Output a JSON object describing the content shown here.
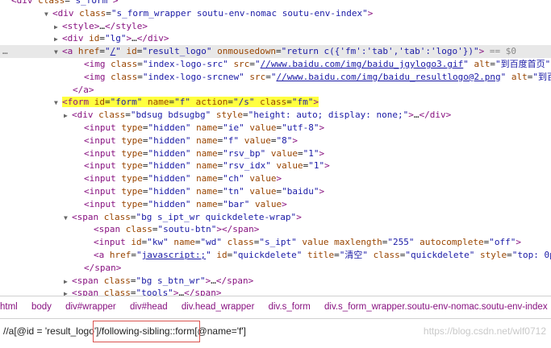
{
  "elements_panel": {
    "lines": [
      {
        "indent": 14,
        "caret": "",
        "html": "<span class='tag'>&lt;div</span> <span class='an'>class</span>=<span class='av'>\"s_form\"</span><span class='tag'>&gt;</span>"
      },
      {
        "indent": 66,
        "caret": "▼",
        "html": "<span class='tag'>&lt;div</span> <span class='an'>class</span>=<span class='av'>\"s_form_wrapper soutu-env-nomac soutu-env-index\"</span><span class='tag'>&gt;</span>"
      },
      {
        "indent": 78,
        "caret": "▶",
        "html": "<span class='tag'>&lt;style&gt;</span>…<span class='tag'>&lt;/style&gt;</span>"
      },
      {
        "indent": 78,
        "caret": "▶",
        "html": "<span class='tag'>&lt;div</span> <span class='an'>id</span>=<span class='av'>\"lg\"</span><span class='tag'>&gt;</span>…<span class='tag'>&lt;/div&gt;</span>"
      },
      {
        "indent": 78,
        "caret": "▼",
        "selected": true,
        "dot": true,
        "html": "<span class='tag'>&lt;a</span> <span class='an'>href</span>=<span class='av'>\"<span class='link'>/</span>\"</span> <span class='an'>id</span>=<span class='av'>\"result_logo\"</span> <span class='an'>onmousedown</span>=<span class='av'>\"return c({'fm':'tab','tab':'logo'})\"</span><span class='tag'>&gt;</span> <span class='dim'>== $0</span>"
      },
      {
        "indent": 104,
        "caret": "",
        "html": "<span class='tag'>&lt;img</span> <span class='an'>class</span>=<span class='av'>\"index-logo-src\"</span> <span class='an'>src</span>=<span class='av'>\"<span class='link'>//www.baidu.com/img/baidu_jgylogo3.gif</span>\"</span> <span class='an'>alt</span>=<span class='av'>\"到百度首页\"</span>"
      },
      {
        "indent": 104,
        "caret": "",
        "html": "<span class='tag'>&lt;img</span> <span class='an'>class</span>=<span class='av'>\"index-logo-srcnew\"</span> <span class='an'>src</span>=<span class='av'>\"<span class='link'>//www.baidu.com/img/baidu_resultlogo@2.png</span>\"</span> <span class='an'>alt</span>=<span class='av'>\"到百</span>"
      },
      {
        "indent": 90,
        "caret": "",
        "html": "<span class='tag'>&lt;/a&gt;</span>"
      },
      {
        "indent": 78,
        "caret": "▼",
        "html": "<span class='hl'><span class='tag'>&lt;form</span> <span class='an'>id</span>=<span class='av'>\"form\"</span> <span class='an'>name</span>=<span class='av'>\"f\"</span> <span class='an'>action</span>=<span class='av'>\"/s\"</span> <span class='an'>class</span>=<span class='av'>\"fm\"</span><span class='tag'>&gt;</span></span>"
      },
      {
        "indent": 90,
        "caret": "▶",
        "html": "<span class='tag'>&lt;div</span> <span class='an'>class</span>=<span class='av'>\"bdsug bdsugbg\"</span> <span class='an'>style</span>=<span class='av'>\"height: auto; display: none;\"</span><span class='tag'>&gt;</span>…<span class='tag'>&lt;/div&gt;</span>"
      },
      {
        "indent": 104,
        "caret": "",
        "html": "<span class='tag'>&lt;input</span> <span class='an'>type</span>=<span class='av'>\"hidden\"</span> <span class='an'>name</span>=<span class='av'>\"ie\"</span> <span class='an'>value</span>=<span class='av'>\"utf-8\"</span><span class='tag'>&gt;</span>"
      },
      {
        "indent": 104,
        "caret": "",
        "html": "<span class='tag'>&lt;input</span> <span class='an'>type</span>=<span class='av'>\"hidden\"</span> <span class='an'>name</span>=<span class='av'>\"f\"</span> <span class='an'>value</span>=<span class='av'>\"8\"</span><span class='tag'>&gt;</span>"
      },
      {
        "indent": 104,
        "caret": "",
        "html": "<span class='tag'>&lt;input</span> <span class='an'>type</span>=<span class='av'>\"hidden\"</span> <span class='an'>name</span>=<span class='av'>\"rsv_bp\"</span> <span class='an'>value</span>=<span class='av'>\"1\"</span><span class='tag'>&gt;</span>"
      },
      {
        "indent": 104,
        "caret": "",
        "html": "<span class='tag'>&lt;input</span> <span class='an'>type</span>=<span class='av'>\"hidden\"</span> <span class='an'>name</span>=<span class='av'>\"rsv_idx\"</span> <span class='an'>value</span>=<span class='av'>\"1\"</span><span class='tag'>&gt;</span>"
      },
      {
        "indent": 104,
        "caret": "",
        "html": "<span class='tag'>&lt;input</span> <span class='an'>type</span>=<span class='av'>\"hidden\"</span> <span class='an'>name</span>=<span class='av'>\"ch\"</span> <span class='an'>value</span><span class='tag'>&gt;</span>"
      },
      {
        "indent": 104,
        "caret": "",
        "html": "<span class='tag'>&lt;input</span> <span class='an'>type</span>=<span class='av'>\"hidden\"</span> <span class='an'>name</span>=<span class='av'>\"tn\"</span> <span class='an'>value</span>=<span class='av'>\"baidu\"</span><span class='tag'>&gt;</span>"
      },
      {
        "indent": 104,
        "caret": "",
        "html": "<span class='tag'>&lt;input</span> <span class='an'>type</span>=<span class='av'>\"hidden\"</span> <span class='an'>name</span>=<span class='av'>\"bar\"</span> <span class='an'>value</span><span class='tag'>&gt;</span>"
      },
      {
        "indent": 90,
        "caret": "▼",
        "html": "<span class='tag'>&lt;span</span> <span class='an'>class</span>=<span class='av'>\"bg s_ipt_wr quickdelete-wrap\"</span><span class='tag'>&gt;</span>"
      },
      {
        "indent": 116,
        "caret": "",
        "html": "<span class='tag'>&lt;span</span> <span class='an'>class</span>=<span class='av'>\"soutu-btn\"</span><span class='tag'>&gt;&lt;/span&gt;</span>"
      },
      {
        "indent": 116,
        "caret": "",
        "html": "<span class='tag'>&lt;input</span> <span class='an'>id</span>=<span class='av'>\"kw\"</span> <span class='an'>name</span>=<span class='av'>\"wd\"</span> <span class='an'>class</span>=<span class='av'>\"s_ipt\"</span> <span class='an'>value</span> <span class='an'>maxlength</span>=<span class='av'>\"255\"</span> <span class='an'>autocomplete</span>=<span class='av'>\"off\"</span><span class='tag'>&gt;</span>"
      },
      {
        "indent": 116,
        "caret": "",
        "html": "<span class='tag'>&lt;a</span> <span class='an'>href</span>=<span class='av'>\"<span class='link'>javascript:;</span>\"</span> <span class='an'>id</span>=<span class='av'>\"quickdelete\"</span> <span class='an'>title</span>=<span class='av'>\"清空\"</span> <span class='an'>class</span>=<span class='av'>\"quickdelete\"</span> <span class='an'>style</span>=<span class='av'>\"top: 0p</span>"
      },
      {
        "indent": 104,
        "caret": "",
        "html": "<span class='tag'>&lt;/span&gt;</span>"
      },
      {
        "indent": 90,
        "caret": "▶",
        "html": "<span class='tag'>&lt;span</span> <span class='an'>class</span>=<span class='av'>\"bg s_btn_wr\"</span><span class='tag'>&gt;</span>…<span class='tag'>&lt;/span&gt;</span>"
      },
      {
        "indent": 90,
        "caret": "▶",
        "html": "<span class='tag'>&lt;span</span> <span class='an'>class</span>=<span class='av'>\"tools\"</span><span class='tag'>&gt;</span>…<span class='tag'>&lt;/span&gt;</span>"
      }
    ]
  },
  "breadcrumb": {
    "items": [
      "html",
      "body",
      "div#wrapper",
      "div#head",
      "div.head_wrapper",
      "div.s_form",
      "div.s_form_wrapper.soutu-env-nomac.soutu-env-index"
    ]
  },
  "xpath_search": {
    "value": "//a[@id = 'result_logo']/following-sibling::form[@name='f']"
  },
  "watermark": {
    "text": "https://blog.csdn.net/wlf0712"
  }
}
